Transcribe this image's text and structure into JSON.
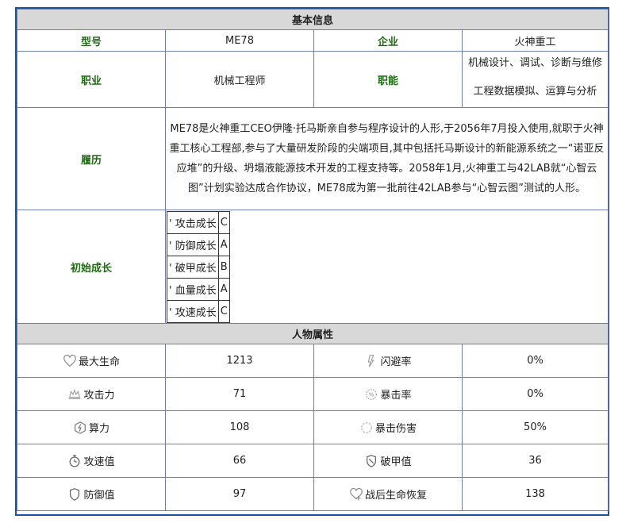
{
  "basic": {
    "header": "基本信息",
    "model_label": "型号",
    "model_value": "ME78",
    "company_label": "企业",
    "company_value": "火神重工",
    "job_label": "职业",
    "job_value": "机械工程师",
    "duty_label": "职能",
    "duty_line1": "机械设计、调试、诊断与维修",
    "duty_line2": "工程数据模拟、运算与分析",
    "bio_label": "履历",
    "bio_text": "ME78是火神重工CEO伊隆·托马斯亲自参与程序设计的人形,于2056年7月投入使用,就职于火神重工核心工程部,参与了大量研发阶段的尖端项目,其中包括托马斯设计的新能源系统之一“诺亚反应堆”的升级、坍塌液能源技术开发的工程支持等。2058年1月,火神重工与42LAB就“心智云图”计划实验达成合作协议，ME78成为第一批前往42LAB参与“心智云图”测试的人形。",
    "growth_label": "初始成长",
    "growth": [
      {
        "mark": "'",
        "name": "攻击成长",
        "grade": "C"
      },
      {
        "mark": "'",
        "name": "防御成长",
        "grade": "A"
      },
      {
        "mark": "'",
        "name": "破甲成长",
        "grade": "B"
      },
      {
        "mark": "'",
        "name": "血量成长",
        "grade": "A"
      },
      {
        "mark": "'",
        "name": "攻速成长",
        "grade": "C"
      }
    ]
  },
  "attrs": {
    "header": "人物属性",
    "rows": [
      {
        "l_icon": "heart-icon",
        "l_name": "最大生命",
        "l_val": "1213",
        "r_icon": "dodge-icon",
        "r_name": "闪避率",
        "r_val": "0%"
      },
      {
        "l_icon": "attack-icon",
        "l_name": "攻击力",
        "l_val": "71",
        "r_icon": "crit-rate-icon",
        "r_name": "暴击率",
        "r_val": "0%"
      },
      {
        "l_icon": "compute-icon",
        "l_name": "算力",
        "l_val": "108",
        "r_icon": "crit-damage-icon",
        "r_name": "暴击伤害",
        "r_val": "50%"
      },
      {
        "l_icon": "stopwatch-icon",
        "l_name": "攻速值",
        "l_val": "66",
        "r_icon": "armor-break-icon",
        "r_name": "破甲值",
        "r_val": "36"
      },
      {
        "l_icon": "shield-icon",
        "l_name": "防御值",
        "l_val": "97",
        "r_icon": "heal-icon",
        "r_name": "战后生命恢复",
        "r_val": "138"
      }
    ]
  }
}
